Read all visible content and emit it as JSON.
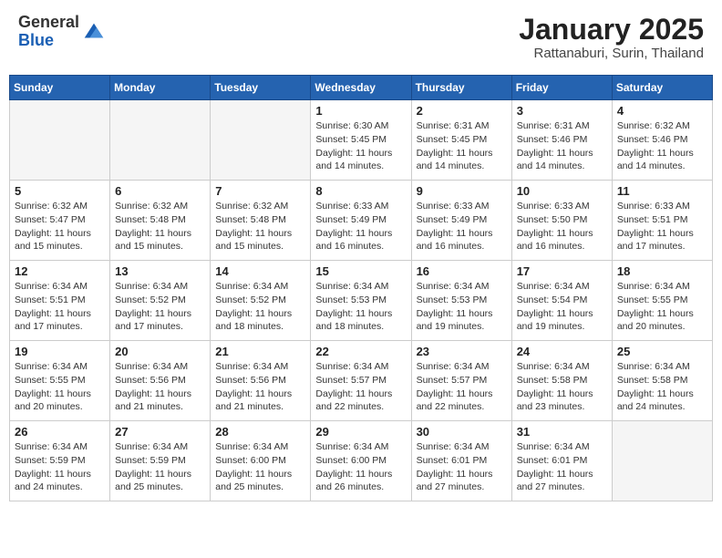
{
  "header": {
    "logo_general": "General",
    "logo_blue": "Blue",
    "month_title": "January 2025",
    "subtitle": "Rattanaburi, Surin, Thailand"
  },
  "weekdays": [
    "Sunday",
    "Monday",
    "Tuesday",
    "Wednesday",
    "Thursday",
    "Friday",
    "Saturday"
  ],
  "weeks": [
    [
      {
        "day": "",
        "info": ""
      },
      {
        "day": "",
        "info": ""
      },
      {
        "day": "",
        "info": ""
      },
      {
        "day": "1",
        "info": "Sunrise: 6:30 AM\nSunset: 5:45 PM\nDaylight: 11 hours\nand 14 minutes."
      },
      {
        "day": "2",
        "info": "Sunrise: 6:31 AM\nSunset: 5:45 PM\nDaylight: 11 hours\nand 14 minutes."
      },
      {
        "day": "3",
        "info": "Sunrise: 6:31 AM\nSunset: 5:46 PM\nDaylight: 11 hours\nand 14 minutes."
      },
      {
        "day": "4",
        "info": "Sunrise: 6:32 AM\nSunset: 5:46 PM\nDaylight: 11 hours\nand 14 minutes."
      }
    ],
    [
      {
        "day": "5",
        "info": "Sunrise: 6:32 AM\nSunset: 5:47 PM\nDaylight: 11 hours\nand 15 minutes."
      },
      {
        "day": "6",
        "info": "Sunrise: 6:32 AM\nSunset: 5:48 PM\nDaylight: 11 hours\nand 15 minutes."
      },
      {
        "day": "7",
        "info": "Sunrise: 6:32 AM\nSunset: 5:48 PM\nDaylight: 11 hours\nand 15 minutes."
      },
      {
        "day": "8",
        "info": "Sunrise: 6:33 AM\nSunset: 5:49 PM\nDaylight: 11 hours\nand 16 minutes."
      },
      {
        "day": "9",
        "info": "Sunrise: 6:33 AM\nSunset: 5:49 PM\nDaylight: 11 hours\nand 16 minutes."
      },
      {
        "day": "10",
        "info": "Sunrise: 6:33 AM\nSunset: 5:50 PM\nDaylight: 11 hours\nand 16 minutes."
      },
      {
        "day": "11",
        "info": "Sunrise: 6:33 AM\nSunset: 5:51 PM\nDaylight: 11 hours\nand 17 minutes."
      }
    ],
    [
      {
        "day": "12",
        "info": "Sunrise: 6:34 AM\nSunset: 5:51 PM\nDaylight: 11 hours\nand 17 minutes."
      },
      {
        "day": "13",
        "info": "Sunrise: 6:34 AM\nSunset: 5:52 PM\nDaylight: 11 hours\nand 17 minutes."
      },
      {
        "day": "14",
        "info": "Sunrise: 6:34 AM\nSunset: 5:52 PM\nDaylight: 11 hours\nand 18 minutes."
      },
      {
        "day": "15",
        "info": "Sunrise: 6:34 AM\nSunset: 5:53 PM\nDaylight: 11 hours\nand 18 minutes."
      },
      {
        "day": "16",
        "info": "Sunrise: 6:34 AM\nSunset: 5:53 PM\nDaylight: 11 hours\nand 19 minutes."
      },
      {
        "day": "17",
        "info": "Sunrise: 6:34 AM\nSunset: 5:54 PM\nDaylight: 11 hours\nand 19 minutes."
      },
      {
        "day": "18",
        "info": "Sunrise: 6:34 AM\nSunset: 5:55 PM\nDaylight: 11 hours\nand 20 minutes."
      }
    ],
    [
      {
        "day": "19",
        "info": "Sunrise: 6:34 AM\nSunset: 5:55 PM\nDaylight: 11 hours\nand 20 minutes."
      },
      {
        "day": "20",
        "info": "Sunrise: 6:34 AM\nSunset: 5:56 PM\nDaylight: 11 hours\nand 21 minutes."
      },
      {
        "day": "21",
        "info": "Sunrise: 6:34 AM\nSunset: 5:56 PM\nDaylight: 11 hours\nand 21 minutes."
      },
      {
        "day": "22",
        "info": "Sunrise: 6:34 AM\nSunset: 5:57 PM\nDaylight: 11 hours\nand 22 minutes."
      },
      {
        "day": "23",
        "info": "Sunrise: 6:34 AM\nSunset: 5:57 PM\nDaylight: 11 hours\nand 22 minutes."
      },
      {
        "day": "24",
        "info": "Sunrise: 6:34 AM\nSunset: 5:58 PM\nDaylight: 11 hours\nand 23 minutes."
      },
      {
        "day": "25",
        "info": "Sunrise: 6:34 AM\nSunset: 5:58 PM\nDaylight: 11 hours\nand 24 minutes."
      }
    ],
    [
      {
        "day": "26",
        "info": "Sunrise: 6:34 AM\nSunset: 5:59 PM\nDaylight: 11 hours\nand 24 minutes."
      },
      {
        "day": "27",
        "info": "Sunrise: 6:34 AM\nSunset: 5:59 PM\nDaylight: 11 hours\nand 25 minutes."
      },
      {
        "day": "28",
        "info": "Sunrise: 6:34 AM\nSunset: 6:00 PM\nDaylight: 11 hours\nand 25 minutes."
      },
      {
        "day": "29",
        "info": "Sunrise: 6:34 AM\nSunset: 6:00 PM\nDaylight: 11 hours\nand 26 minutes."
      },
      {
        "day": "30",
        "info": "Sunrise: 6:34 AM\nSunset: 6:01 PM\nDaylight: 11 hours\nand 27 minutes."
      },
      {
        "day": "31",
        "info": "Sunrise: 6:34 AM\nSunset: 6:01 PM\nDaylight: 11 hours\nand 27 minutes."
      },
      {
        "day": "",
        "info": ""
      }
    ]
  ]
}
